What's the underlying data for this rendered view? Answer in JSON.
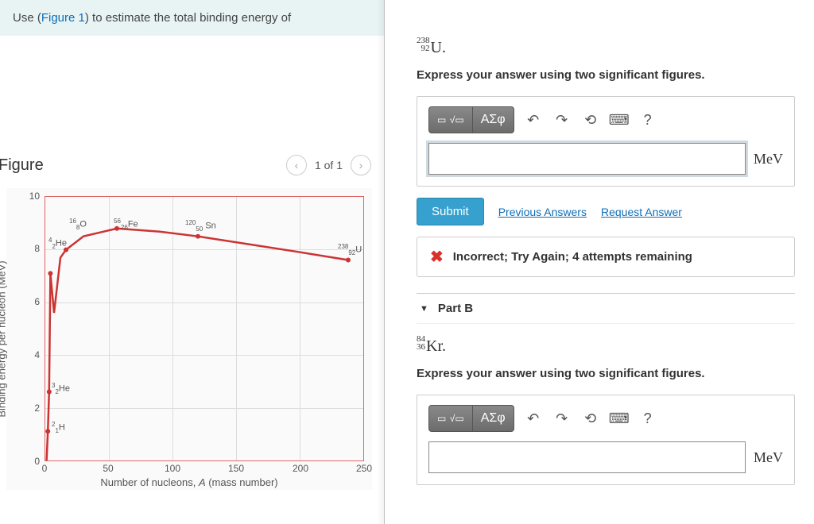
{
  "left": {
    "instruction_prefix": "Use (",
    "instruction_link": "Figure 1",
    "instruction_suffix": ") to estimate the total binding energy of",
    "figure_title": "Figure",
    "pager_text": "1 of 1"
  },
  "chart_data": {
    "type": "line",
    "xlabel": "Number of nucleons, A (mass number)",
    "ylabel": "Binding energy per nucleon (MeV)",
    "xlim": [
      0,
      250
    ],
    "ylim": [
      0,
      10
    ],
    "xticks": [
      0,
      50,
      100,
      150,
      200,
      250
    ],
    "yticks": [
      0,
      2,
      4,
      6,
      8,
      10
    ],
    "series": [
      {
        "name": "binding-energy",
        "x": [
          1,
          2,
          3,
          4,
          7,
          12,
          16,
          30,
          56,
          90,
          120,
          160,
          200,
          238
        ],
        "y": [
          0,
          1.1,
          2.6,
          7.1,
          5.6,
          7.7,
          8.0,
          8.5,
          8.8,
          8.7,
          8.5,
          8.2,
          7.9,
          7.6
        ]
      }
    ],
    "labeled_points": [
      {
        "label": "2/1 H",
        "A": 2,
        "y": 1.1
      },
      {
        "label": "3/2 He",
        "A": 3,
        "y": 2.6
      },
      {
        "label": "4/2 He",
        "A": 4,
        "y": 7.1
      },
      {
        "label": "16/8 O",
        "A": 16,
        "y": 8.0
      },
      {
        "label": "56/26 Fe",
        "A": 56,
        "y": 8.8
      },
      {
        "label": "120/50 Sn",
        "A": 120,
        "y": 8.5
      },
      {
        "label": "238/92 U",
        "A": 238,
        "y": 7.6
      }
    ]
  },
  "right": {
    "partA": {
      "isotope_top": "238",
      "isotope_bottom": "92",
      "isotope_symbol": "U.",
      "instruction": "Express your answer using two significant figures.",
      "greek_btn": "ΑΣφ",
      "unit": "MeV",
      "submit": "Submit",
      "prev_answers": "Previous Answers",
      "request_answer": "Request Answer",
      "feedback": "Incorrect; Try Again; 4 attempts remaining"
    },
    "partB": {
      "header": "Part B",
      "isotope_top": "84",
      "isotope_bottom": "36",
      "isotope_symbol": "Kr.",
      "instruction": "Express your answer using two significant figures.",
      "greek_btn": "ΑΣφ",
      "unit": "MeV"
    }
  }
}
